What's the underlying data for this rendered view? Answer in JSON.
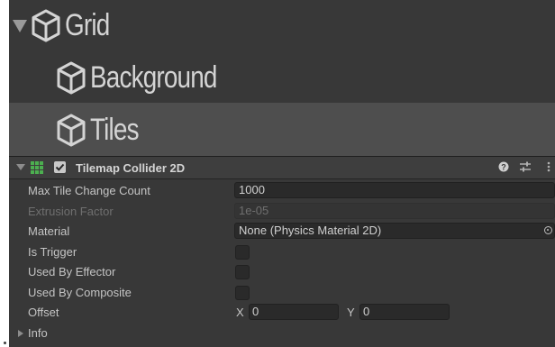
{
  "hierarchy": {
    "items": [
      {
        "label": "Grid"
      },
      {
        "label": "Background"
      },
      {
        "label": "Tiles"
      }
    ]
  },
  "component": {
    "title": "Tilemap Collider 2D",
    "enabled": true,
    "icons": [
      "help-icon",
      "preset-icon",
      "more-options-icon"
    ]
  },
  "properties": {
    "max_tile_change_count": {
      "label": "Max Tile Change Count",
      "value": "1000"
    },
    "extrusion_factor": {
      "label": "Extrusion Factor",
      "value": "1e-05"
    },
    "material": {
      "label": "Material",
      "value": "None (Physics Material 2D)"
    },
    "is_trigger": {
      "label": "Is Trigger",
      "checked": false
    },
    "used_by_effector": {
      "label": "Used By Effector",
      "checked": false
    },
    "used_by_composite": {
      "label": "Used By Composite",
      "checked": false
    },
    "offset": {
      "label": "Offset",
      "x_label": "X",
      "x": "0",
      "y_label": "Y",
      "y": "0"
    },
    "info": {
      "label": "Info"
    }
  },
  "colors": {
    "panel_bg": "#383838",
    "selected_row": "#4e4e4e",
    "field_bg": "#2a2a2a",
    "text": "#c4c4c4",
    "grid_icon": "#4caf50"
  }
}
